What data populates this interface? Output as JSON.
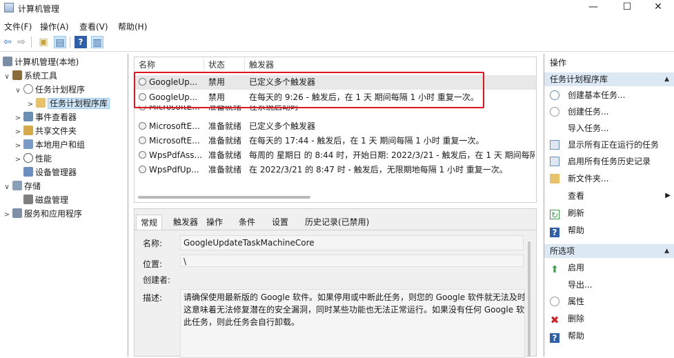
{
  "window": {
    "title": "计算机管理",
    "controls": {
      "minimize": "—",
      "maximize": "☐",
      "close": "✕"
    }
  },
  "menu": [
    "文件(F)",
    "操作(A)",
    "查看(V)",
    "帮助(H)"
  ],
  "tree": {
    "root": "计算机管理(本地)",
    "items": [
      {
        "label": "系统工具",
        "toggle": "∨",
        "icon_color": "#8a6d3b"
      },
      {
        "label": "任务计划程序",
        "toggle": "∨",
        "icon_color": "#9a9a9a"
      },
      {
        "label": "任务计划程序库",
        "toggle": ">",
        "icon_color": "#e8c26a"
      },
      {
        "label": "事件查看器",
        "toggle": ">",
        "icon_color": "#6b8fb3"
      },
      {
        "label": "共享文件夹",
        "toggle": ">",
        "icon_color": "#d6a94a"
      },
      {
        "label": "本地用户和组",
        "toggle": ">",
        "icon_color": "#7a9cc6"
      },
      {
        "label": "性能",
        "toggle": ">",
        "icon_color": "#c0392b"
      },
      {
        "label": "设备管理器",
        "toggle": "",
        "icon_color": "#6d8fbf"
      },
      {
        "label": "存储",
        "toggle": "∨",
        "icon_color": "#8aa0b8"
      },
      {
        "label": "磁盘管理",
        "toggle": "",
        "icon_color": "#7f7f7f"
      },
      {
        "label": "服务和应用程序",
        "toggle": ">",
        "icon_color": "#7f8fa8"
      }
    ]
  },
  "task_list": {
    "columns": [
      "名称",
      "状态",
      "触发器"
    ],
    "rows": [
      {
        "name": "GoogleUp...",
        "status": "禁用",
        "trigger": "已定义多个触发器"
      },
      {
        "name": "GoogleUp...",
        "status": "禁用",
        "trigger": "在每天的 9:26 - 触发后，在 1 天 期间每隔 1 小时 重复一次。"
      },
      {
        "name": "MicrosoftE...",
        "status": "准备就绪",
        "trigger": "在系统启动时"
      },
      {
        "name": "MicrosoftE...",
        "status": "准备就绪",
        "trigger": "已定义多个触发器"
      },
      {
        "name": "MicrosoftE...",
        "status": "准备就绪",
        "trigger": "在每天的 17:44 - 触发后，在 1 天 期间每隔 1 小时 重复一次。"
      },
      {
        "name": "WpsPdfAss...",
        "status": "准备就绪",
        "trigger": "每周的 星期日 的 8:44 时，开始日期: 2022/3/21 - 触发后，在 1 天 期间每隔"
      },
      {
        "name": "WpsPdfUp...",
        "status": "准备就绪",
        "trigger": "在 2022/3/21 的 8:47 时 - 触发后，无限期地每隔 1 小时 重复一次。"
      }
    ]
  },
  "detail": {
    "tabs": [
      "常规",
      "触发器",
      "操作",
      "条件",
      "设置",
      "历史记录(已禁用)"
    ],
    "name_label": "名称:",
    "name_value": "GoogleUpdateTaskMachineCore",
    "location_label": "位置:",
    "location_value": "\\",
    "author_label": "创建者:",
    "desc_label": "描述:",
    "desc_lines": [
      "请确保使用最新版的 Google 软件。如果停用或中断此任务，则您的 Google 软件就无法及时",
      "这意味着无法修复潜在的安全漏洞，同时某些功能也无法正常运行。如果没有任何 Google 软",
      "此任务，则此任务会自行卸载。"
    ]
  },
  "actions": {
    "header": "操作",
    "group1": "任务计划程序库",
    "group1_items": [
      {
        "label": "创建基本任务...",
        "icon": "clock-icon",
        "color": "#6b8fb3"
      },
      {
        "label": "创建任务...",
        "icon": "clock-icon",
        "color": "#9a9a9a"
      },
      {
        "label": "导入任务...",
        "icon": "",
        "color": ""
      },
      {
        "label": "显示所有正在运行的任务",
        "icon": "list-icon",
        "color": "#6b8fb3"
      },
      {
        "label": "启用所有任务历史记录",
        "icon": "history-icon",
        "color": "#6b8fb3"
      },
      {
        "label": "新文件夹...",
        "icon": "folder-icon",
        "color": "#e8c26a"
      },
      {
        "label": "查看",
        "icon": "",
        "color": ""
      },
      {
        "label": "刷新",
        "icon": "refresh-icon",
        "color": "#3a9a4a"
      },
      {
        "label": "帮助",
        "icon": "help-icon",
        "color": "#2f5fa8"
      }
    ],
    "group2": "所选项",
    "group2_items": [
      {
        "label": "启用",
        "icon": "arrow-up-icon",
        "color": "#3aa04a"
      },
      {
        "label": "导出...",
        "icon": "",
        "color": ""
      },
      {
        "label": "属性",
        "icon": "clock-icon",
        "color": "#9a9a9a"
      },
      {
        "label": "删除",
        "icon": "delete-icon",
        "color": "#d4222a"
      },
      {
        "label": "帮助",
        "icon": "help-icon",
        "color": "#2f5fa8"
      }
    ]
  },
  "highlight_color": "#e0141e"
}
